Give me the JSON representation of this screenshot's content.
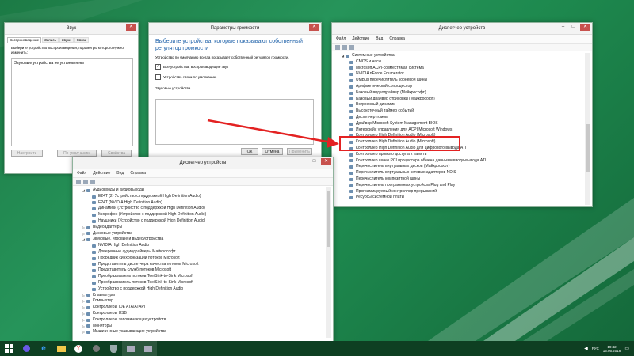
{
  "sound_window": {
    "title": "Звук",
    "tabs": [
      "Воспроизведение",
      "Запись",
      "Звуки",
      "Связь"
    ],
    "hint": "Выберите устройство воспроизведения, параметры которого нужно изменить:",
    "empty_text": "Звуковые устройства не установлены",
    "buttons": {
      "configure": "Настроить",
      "default": "По умолчанию",
      "properties": "Свойства"
    }
  },
  "volume_window": {
    "title": "Параметры громкости",
    "heading": "Выберите устройства, которые показывают собственный регулятор громкости",
    "description": "Устройство по умолчанию всегда показывает собственный регулятор громкости.",
    "check_all": "Все устройства, воспроизводящие звук",
    "check_comm": "Устройства связи по умолчанию",
    "section_label": "Звуковые устройства",
    "buttons": {
      "ok": "ОК",
      "cancel": "Отмена",
      "apply": "Применить"
    }
  },
  "devmgr_right": {
    "title": "Диспетчер устройств",
    "menu": [
      "Файл",
      "Действие",
      "Вид",
      "Справка"
    ],
    "items": [
      "Системные устройства",
      "CMOS и часы",
      "Microsoft ACPI-совместимая система",
      "NVIDIA nForce Enumerator",
      "UMBus перечислитель корневой шины",
      "Арифметический сопроцессор",
      "Базовый видеодрайвер (Майкрософт)",
      "Базовый драйвер отрисовки (Майкрософт)",
      "Встроенный динамик",
      "Высокоточный таймер событий",
      "Диспетчер томов",
      "Драйвер Microsoft System Management BIOS",
      "Интерфейс управления для ACPI Microsoft Windows",
      "Контроллер High Definition Audio (Microsoft)",
      "Контроллер High Definition Audio (Microsoft)",
      "Контроллер High Definition Audio для цифрового вывода ATI",
      "Контроллер прямого доступа к памяти",
      "Контроллер шины PCI процессора обмена данными ввода-вывода ATI",
      "Перечислитель виртуальных дисков (Майкрософт)",
      "Перечислитель виртуальных сетевых адаптеров NDIS",
      "Перечислитель композитной шины",
      "Перечислитель программных устройств Plug and Play",
      "Программируемый контроллер прерываний",
      "Ресурсы системной платы"
    ]
  },
  "devmgr_bottom": {
    "title": "Диспетчер устройств",
    "menu": [
      "Файл",
      "Действие",
      "Вид",
      "Справка"
    ],
    "items": [
      {
        "label": "Аудиовходы и аудиовыходы",
        "level": 1,
        "exp": "◢"
      },
      {
        "label": "E24T (2- Устройство с поддержкой High Definition Audio)",
        "level": 2
      },
      {
        "label": "E24T (NVIDIA High Definition Audio)",
        "level": 2
      },
      {
        "label": "Динамики (Устройство с поддержкой High Definition Audio)",
        "level": 2
      },
      {
        "label": "Микрофон (Устройство с поддержкой High Definition Audio)",
        "level": 2
      },
      {
        "label": "Наушники (Устройство с поддержкой High Definition Audio)",
        "level": 2
      },
      {
        "label": "Видеоадаптеры",
        "level": 1,
        "exp": "▷"
      },
      {
        "label": "Дисковые устройства",
        "level": 1,
        "exp": "▷"
      },
      {
        "label": "Звуковые, игровые и видеоустройства",
        "level": 1,
        "exp": "◢"
      },
      {
        "label": "NVIDIA High Definition Audio",
        "level": 2
      },
      {
        "label": "Доверенные аудиодрайверы Майкрософт",
        "level": 2
      },
      {
        "label": "Посредник синхронизации потоков Microsoft",
        "level": 2
      },
      {
        "label": "Представитель диспетчера качества потоков Microsoft",
        "level": 2
      },
      {
        "label": "Представитель служб потоков Microsoft",
        "level": 2
      },
      {
        "label": "Преобразователь потоков Tee/Sink-to-Sink Microsoft",
        "level": 2
      },
      {
        "label": "Преобразователь потоков Tee/Sink-to-Sink Microsoft",
        "level": 2
      },
      {
        "label": "Устройство с поддержкой High Definition Audio",
        "level": 2
      },
      {
        "label": "Клавиатуры",
        "level": 1,
        "exp": "▷"
      },
      {
        "label": "Компьютер",
        "level": 1,
        "exp": "▷"
      },
      {
        "label": "Контроллеры IDE ATA/ATAPI",
        "level": 1,
        "exp": "▷"
      },
      {
        "label": "Контроллеры USB",
        "level": 1,
        "exp": "▷"
      },
      {
        "label": "Контроллеры запоминающих устройств",
        "level": 1,
        "exp": "▷"
      },
      {
        "label": "Мониторы",
        "level": 1,
        "exp": "▷"
      },
      {
        "label": "Мыши и иные указывающие устройства",
        "level": 1,
        "exp": "▷"
      }
    ]
  },
  "taskbar": {
    "lang": "РУС",
    "time": "19:42",
    "date": "15.05.2018"
  },
  "colors": {
    "highlight": "#e32222",
    "desktop": "#1e8a4f",
    "taskbar": "#0e3f22"
  }
}
